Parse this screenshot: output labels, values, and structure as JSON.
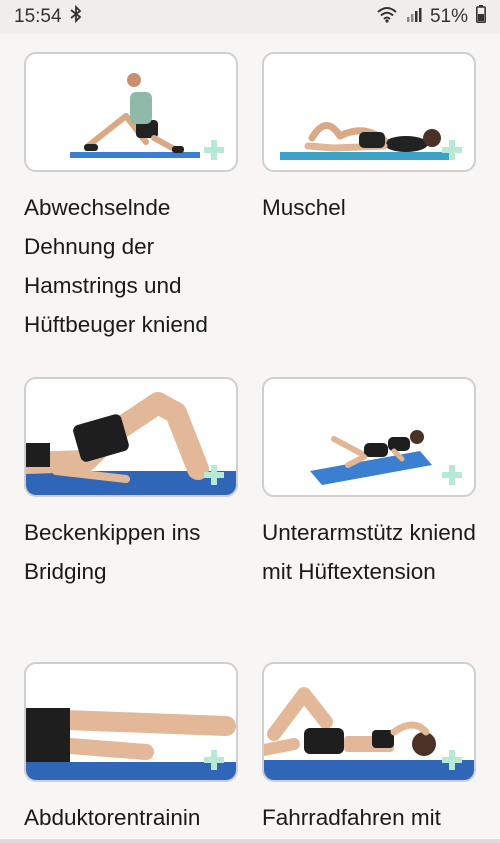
{
  "status_bar": {
    "time": "15:54",
    "battery": "51%",
    "icons": [
      "bluetooth-icon",
      "wifi-icon",
      "signal-icon",
      "battery-icon"
    ]
  },
  "exercises": [
    {
      "title": "Abwechselnde Dehnung der Hamstrings und Hüftbeuger kniend"
    },
    {
      "title": "Muschel"
    },
    {
      "title": "Beckenkippen ins Bridging"
    },
    {
      "title": "Unterarmstütz kniend mit Hüftextension"
    },
    {
      "title": "Abduktorentrainin"
    },
    {
      "title": "Fahrradfahren mit"
    }
  ],
  "colors": {
    "mat_blue": "#3b7fd1",
    "mat_teal": "#3aa3c7",
    "plus_mint": "#b6ead5",
    "card_border": "#cfcfcf"
  }
}
